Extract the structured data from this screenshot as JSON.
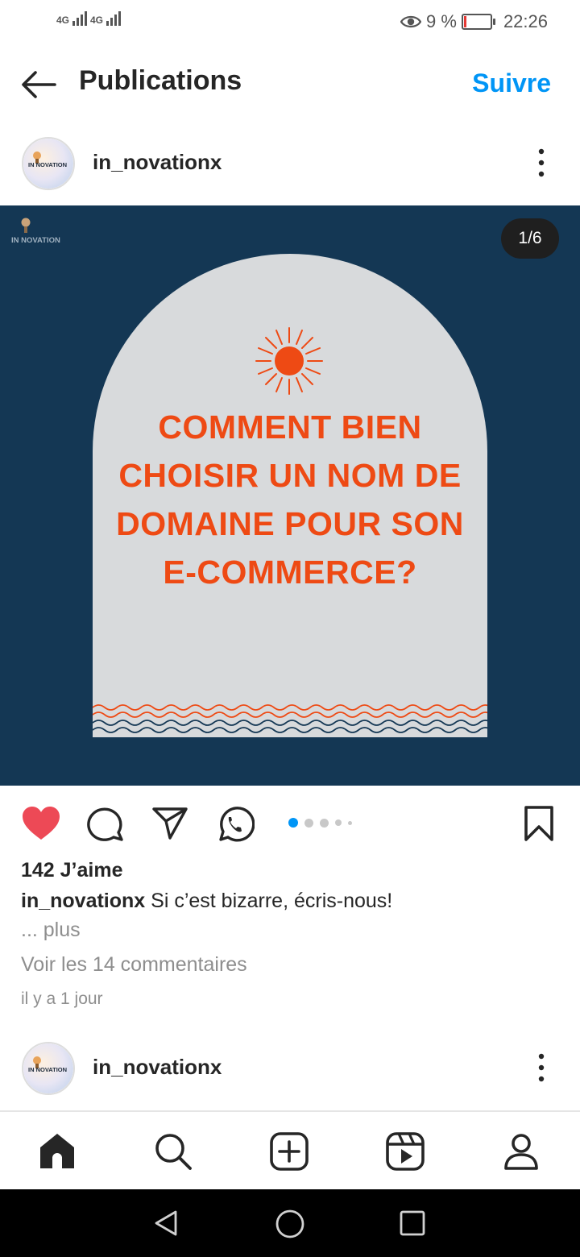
{
  "status_bar": {
    "signal_1": "4G",
    "signal_2": "4G",
    "battery_percent": "9 %",
    "time": "22:26"
  },
  "header": {
    "title": "Publications",
    "follow_label": "Suivre"
  },
  "post": {
    "username": "in_novationx",
    "page_indicator": "1/6",
    "image_watermark": "IN NOVATION",
    "avatar_text": "IN NOVATION",
    "headline": "COMMENT BIEN CHOISIR UN NOM DE DOMAINE POUR SON E-COMMERCE?",
    "likes": "142 J’aime",
    "caption_username": "in_novationx",
    "caption_text": "Si c’est bizarre, écris-nous!",
    "more_label": "... plus",
    "comments_link": "Voir les 14 commentaires",
    "time_ago": "il y a 1 jour",
    "liked": true,
    "active_slide": 1,
    "total_slides": 6
  },
  "next_post": {
    "username": "in_novationx",
    "avatar_text": "IN NOVATION"
  },
  "colors": {
    "accent": "#0095f6",
    "heart": "#ed4956",
    "image_bg": "#143754",
    "headline": "#ee4a14",
    "arch": "#d8dadc"
  },
  "icons": [
    "back-arrow-icon",
    "more-vertical-icon",
    "heart-icon",
    "comment-icon",
    "share-icon",
    "whatsapp-icon",
    "bookmark-icon",
    "home-icon",
    "search-icon",
    "add-post-icon",
    "reels-icon",
    "profile-icon",
    "system-back-icon",
    "system-home-icon",
    "system-recents-icon"
  ]
}
